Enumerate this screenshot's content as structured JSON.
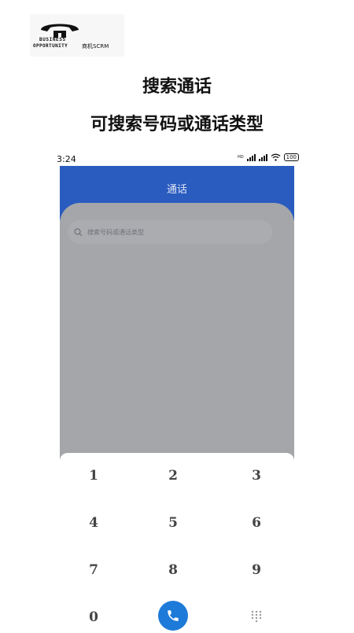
{
  "logo": {
    "line1": "BUSINESS",
    "line2": "OPPORTUNITY",
    "brand": "商机SCRM",
    "icon": "telephone-handset-logo"
  },
  "headline": {
    "title": "搜索通话",
    "subtitle": "可搜索号码或通话类型"
  },
  "status_bar": {
    "time": "3:24",
    "hd_label": "HD",
    "battery": "100"
  },
  "app": {
    "title": "通话",
    "search_placeholder": "搜索号码或通话类型",
    "header_color": "#2a5bbf"
  },
  "dialpad": {
    "keys": [
      "1",
      "2",
      "3",
      "4",
      "5",
      "6",
      "7",
      "8",
      "9",
      "0"
    ],
    "call_color": "#1e7ad8"
  }
}
